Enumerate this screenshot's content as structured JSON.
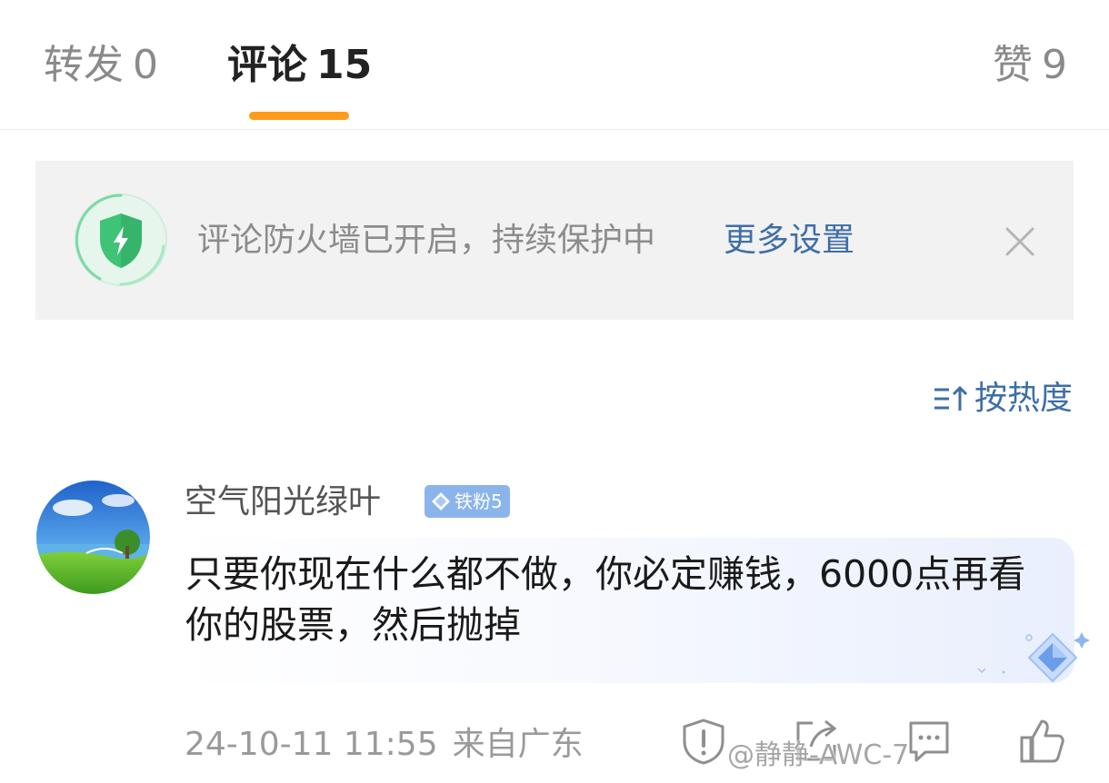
{
  "tabs": {
    "repost": {
      "label": "转发",
      "count": "0"
    },
    "comment": {
      "label": "评论",
      "count": "15"
    },
    "like": {
      "label": "赞",
      "count": "9"
    }
  },
  "notice": {
    "text": "评论防火墙已开启，持续保护中",
    "link": "更多设置",
    "icon": "shield-lightning-icon",
    "close_icon": "close-icon"
  },
  "sort": {
    "label": "按热度",
    "icon": "sort-icon"
  },
  "comment": {
    "username": "空气阳光绿叶",
    "badge": "铁粉5",
    "text": "只要你现在什么都不做，你必定赚钱，6000点再看你的股票，然后抛掉",
    "date": "24-10-11 11:55",
    "location": "来自广东",
    "actions": [
      "report-icon",
      "share-icon",
      "reply-icon",
      "like-icon"
    ]
  },
  "watermark": "@静静-AWC-7",
  "colors": {
    "accent_orange": "#ff9a1a",
    "link_blue": "#3e6ea6",
    "shield_green": "#3fc477",
    "badge_blue": "#8bb4ec"
  }
}
